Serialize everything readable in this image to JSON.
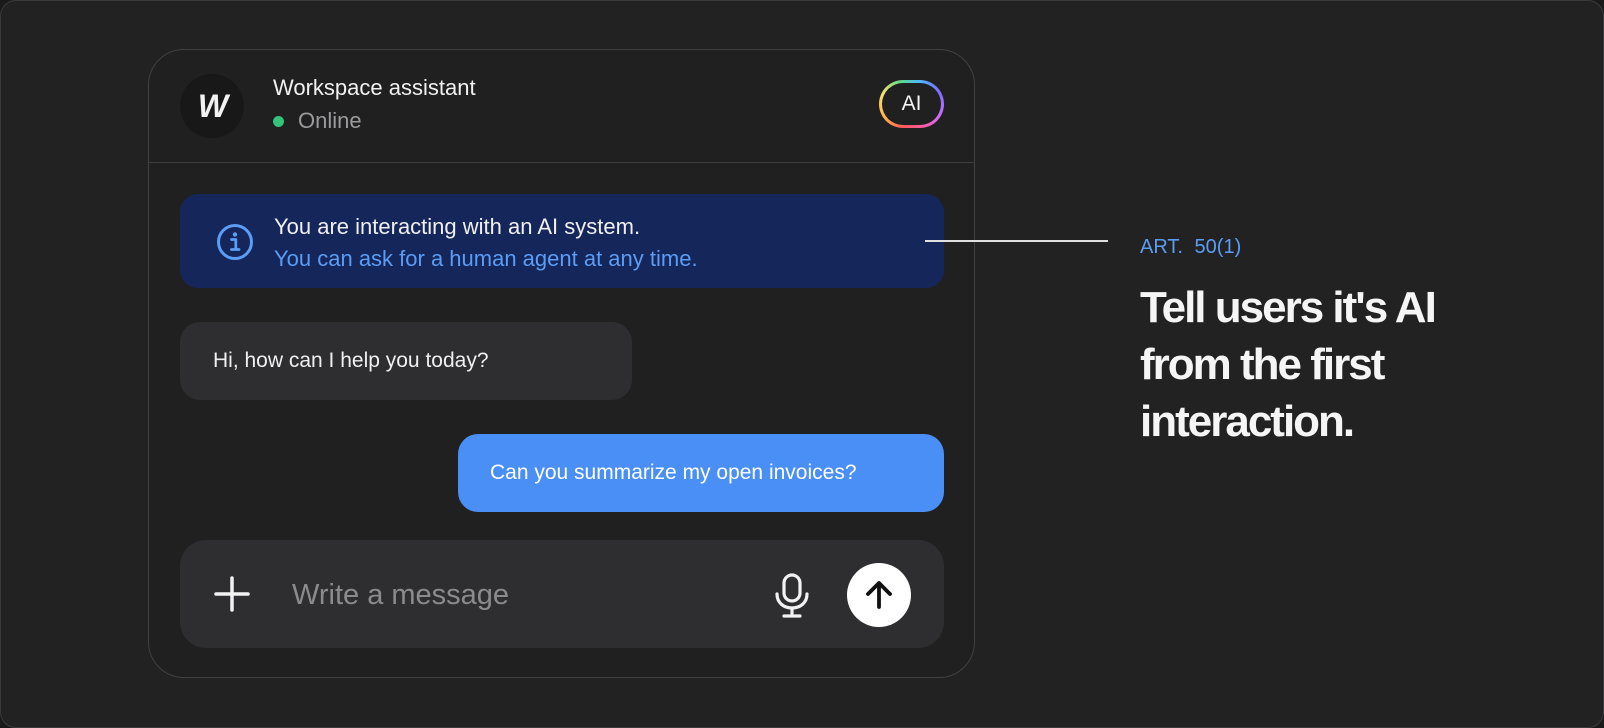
{
  "header": {
    "avatar_letter": "W",
    "title": "Workspace assistant",
    "status": "Online",
    "ai_badge": "AI"
  },
  "notice": {
    "line1": "You are interacting with an AI system.",
    "line2": "You can ask for a human agent at any time.",
    "icon": "info-icon"
  },
  "messages": [
    {
      "role": "assistant",
      "text": "Hi, how can I help you today?"
    },
    {
      "role": "user",
      "text": "Can you summarize my open invoices?"
    }
  ],
  "composer": {
    "placeholder": "Write a message",
    "add_icon": "plus-icon",
    "mic_icon": "microphone-icon",
    "send_icon": "arrow-up-icon"
  },
  "annotation": {
    "article": "ART. 50(1)",
    "headline": "Tell users it's AI from the first interaction."
  },
  "colors": {
    "status_online": "#33c37a",
    "notice_bg": "#15265a",
    "accent_blue": "#5b9cf5",
    "user_bubble": "#4a8ff6"
  }
}
